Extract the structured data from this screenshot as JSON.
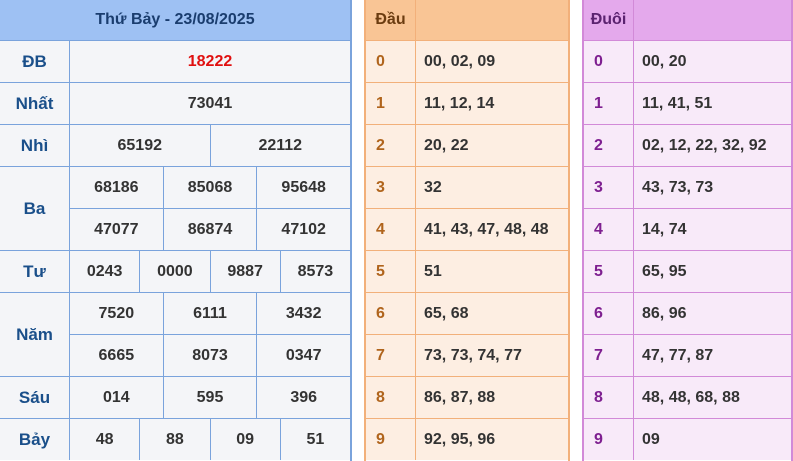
{
  "results": {
    "title": "Thứ Bảy - 23/08/2025",
    "prizes": [
      {
        "label": "ĐB",
        "lines": [
          [
            "18222"
          ]
        ],
        "special": true
      },
      {
        "label": "Nhất",
        "lines": [
          [
            "73041"
          ]
        ]
      },
      {
        "label": "Nhì",
        "lines": [
          [
            "65192",
            "22112"
          ]
        ]
      },
      {
        "label": "Ba",
        "lines": [
          [
            "68186",
            "85068",
            "95648"
          ],
          [
            "47077",
            "86874",
            "47102"
          ]
        ]
      },
      {
        "label": "Tư",
        "lines": [
          [
            "0243",
            "0000",
            "9887",
            "8573"
          ]
        ]
      },
      {
        "label": "Năm",
        "lines": [
          [
            "7520",
            "6111",
            "3432"
          ],
          [
            "6665",
            "8073",
            "0347"
          ]
        ]
      },
      {
        "label": "Sáu",
        "lines": [
          [
            "014",
            "595",
            "396"
          ]
        ]
      },
      {
        "label": "Bảy",
        "lines": [
          [
            "48",
            "88",
            "09",
            "51"
          ]
        ]
      }
    ]
  },
  "dau": {
    "header": "Đầu",
    "rows": [
      {
        "key": "0",
        "value": "00, 02, 09"
      },
      {
        "key": "1",
        "value": "11, 12, 14"
      },
      {
        "key": "2",
        "value": "20, 22"
      },
      {
        "key": "3",
        "value": "32"
      },
      {
        "key": "4",
        "value": "41, 43, 47, 48, 48"
      },
      {
        "key": "5",
        "value": "51"
      },
      {
        "key": "6",
        "value": "65, 68"
      },
      {
        "key": "7",
        "value": "73, 73, 74, 77"
      },
      {
        "key": "8",
        "value": "86, 87, 88"
      },
      {
        "key": "9",
        "value": "92, 95, 96"
      }
    ]
  },
  "duoi": {
    "header": "Đuôi",
    "rows": [
      {
        "key": "0",
        "value": "00, 20"
      },
      {
        "key": "1",
        "value": "11, 41, 51"
      },
      {
        "key": "2",
        "value": "02, 12, 22, 32, 92"
      },
      {
        "key": "3",
        "value": "43, 73, 73"
      },
      {
        "key": "4",
        "value": "14, 74"
      },
      {
        "key": "5",
        "value": "65, 95"
      },
      {
        "key": "6",
        "value": "86, 96"
      },
      {
        "key": "7",
        "value": "47, 77, 87"
      },
      {
        "key": "8",
        "value": "48, 48, 68, 88"
      },
      {
        "key": "9",
        "value": "09"
      }
    ]
  },
  "colors": {
    "special_number": "#e01010",
    "results_header_bg": "#9ec1f3",
    "dau_header_bg": "#f9c595",
    "duoi_header_bg": "#e4a9ec"
  }
}
